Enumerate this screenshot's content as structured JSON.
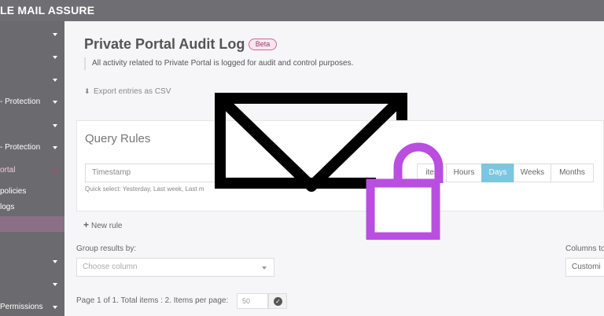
{
  "app": {
    "brand": "LE MAIL ASSURE"
  },
  "sidebar": {
    "items": [
      {
        "label": "",
        "chevron": "down"
      },
      {
        "label": "",
        "chevron": "down"
      },
      {
        "label": "",
        "chevron": "down"
      },
      {
        "label": "- Protection",
        "chevron": "down"
      },
      {
        "label": "",
        "chevron": "down"
      },
      {
        "label": "- Protection",
        "chevron": "down"
      },
      {
        "label": "ortal",
        "chevron": "up"
      },
      {
        "label": "policies",
        "chevron": ""
      },
      {
        "label": "logs",
        "chevron": ""
      },
      {
        "label": "",
        "chevron": "down"
      },
      {
        "label": "",
        "chevron": "down"
      },
      {
        "label": "Permissions",
        "chevron": "down"
      }
    ]
  },
  "page": {
    "title": "Private Portal Audit Log",
    "badge": "Beta",
    "description": "All activity related to Private Portal is logged for audit and control purposes.",
    "export_label": "Export entries as CSV",
    "export_icon": "download-icon"
  },
  "query": {
    "title": "Query Rules",
    "field_value": "Timestamp",
    "quick_select": "Quick select: Yesterday, Last week, Last m",
    "units": [
      {
        "label": "ites",
        "active": false
      },
      {
        "label": "Hours",
        "active": false
      },
      {
        "label": "Days",
        "active": true
      },
      {
        "label": "Weeks",
        "active": false
      },
      {
        "label": "Months",
        "active": false
      }
    ],
    "active_color": "#7cc6df",
    "new_rule": "New rule"
  },
  "grouping": {
    "label": "Group results by:",
    "placeholder": "Choose column"
  },
  "columns": {
    "label": "Columns to",
    "value": "Customi"
  },
  "pagination": {
    "text": "Page 1 of 1. Total items : 2. Items per page:",
    "per_page": "50"
  },
  "overlay": {
    "envelope_icon": "envelope-icon",
    "lock_icon": "padlock-icon",
    "lock_color": "#b94ee0"
  }
}
